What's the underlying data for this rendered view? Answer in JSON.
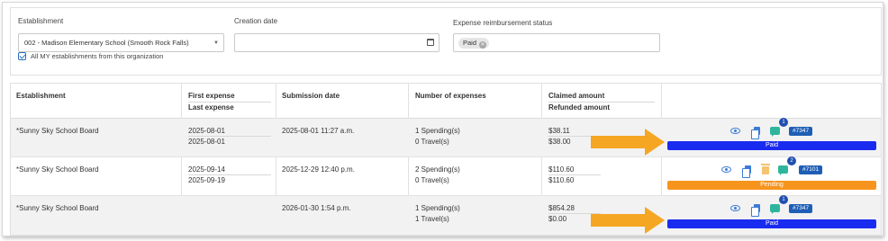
{
  "colors": {
    "paid": "#1a2bf0",
    "pending": "#f7941d",
    "arrow": "#f5a623",
    "badge": "#1f5eb5"
  },
  "filters": {
    "establishment": {
      "label": "Establishment",
      "value": "002 - Madison Elementary School (Smooth Rock Falls)",
      "checkbox_label": "All MY establishments from this organization",
      "checked": true
    },
    "creation_date": {
      "label": "Creation date",
      "value": ""
    },
    "reimbursement_status": {
      "label": "Expense reimbursement status",
      "chips": [
        "Paid"
      ]
    }
  },
  "table": {
    "headers": {
      "establishment": "Establishment",
      "first_expense": "First expense",
      "last_expense": "Last expense",
      "submission_date": "Submission date",
      "number_of_expenses": "Number of expenses",
      "claimed_amount": "Claimed amount",
      "refunded_amount": "Refunded amount"
    },
    "rows": [
      {
        "establishment": "*Sunny Sky School Board",
        "first_expense": "2025-08-01",
        "last_expense": "2025-08-01",
        "submission_date": "2025-08-01 11:27 a.m.",
        "spendings": "1 Spending(s)",
        "travels": "0 Travel(s)",
        "claimed": "$38.11",
        "refunded": "$38.00",
        "message_count": "1",
        "ref": "#7347",
        "status": "Paid",
        "status_type": "paid",
        "deletable": false
      },
      {
        "establishment": "*Sunny Sky School Board",
        "first_expense": "2025-09-14",
        "last_expense": "2025-09-19",
        "submission_date": "2025-12-29 12:40 p.m.",
        "spendings": "2 Spending(s)",
        "travels": "0 Travel(s)",
        "claimed": "$110.60",
        "refunded": "$110.60",
        "message_count": "2",
        "ref": "#7101",
        "status": "Pending",
        "status_type": "pending",
        "deletable": true
      },
      {
        "establishment": "*Sunny Sky School Board",
        "first_expense": "",
        "last_expense": "",
        "submission_date": "2026-01-30 1:54 p.m.",
        "spendings": "1 Spending(s)",
        "travels": "1 Travel(s)",
        "claimed": "$854.28",
        "refunded": "$0.00",
        "message_count": "1",
        "ref": "#7347",
        "status": "Paid",
        "status_type": "paid",
        "deletable": false
      }
    ]
  },
  "icons": {
    "view": "eye-icon",
    "copy": "copy-icon",
    "delete": "trash-icon",
    "comments": "chat-icon",
    "clear": "close-icon",
    "calendar": "calendar-icon",
    "dropdown": "chevron-down-icon",
    "annotation": "arrow-right-icon"
  }
}
